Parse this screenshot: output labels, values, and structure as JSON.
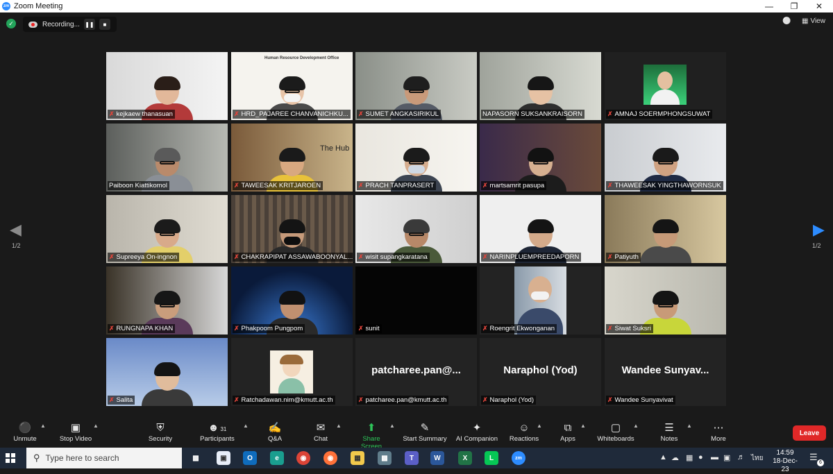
{
  "window": {
    "title": "Zoom Meeting",
    "app_icon_text": "zm",
    "controls": [
      "minimize-icon",
      "maximize-icon",
      "close-icon"
    ]
  },
  "recording": {
    "label": "Recording...",
    "pause_icon": "pause-icon",
    "stop_icon": "stop-icon"
  },
  "view_label": "View",
  "page_indicator": {
    "left": "1/2",
    "right": "1/2"
  },
  "participants": [
    {
      "name": "kejkaew thanasuan",
      "muted": true
    },
    {
      "name": "HRD_PAJAREE CHANVANICHKU...",
      "muted": true,
      "banner": "Human Resource Development Office"
    },
    {
      "name": "SUMET ANGKASIRIKUL",
      "muted": true
    },
    {
      "name": "NAPASORN SUKSANKRAISORN",
      "muted": false,
      "active": true
    },
    {
      "name": "AMNAJ SOERMPHONGSUWAT",
      "muted": true
    },
    {
      "name": "Paiboon Kiattikomol",
      "muted": false
    },
    {
      "name": "TAWEESAK KRITJAROEN",
      "muted": true,
      "banner": "The Hub"
    },
    {
      "name": "PRACH TANPRASERT",
      "muted": true
    },
    {
      "name": "martsamrit pasupa",
      "muted": true
    },
    {
      "name": "THAWEESAK YINGTHAWORNSUK",
      "muted": true
    },
    {
      "name": "Supreeya On-ingnon",
      "muted": true
    },
    {
      "name": "CHAKRAPIPAT ASSAWABOONYAL...",
      "muted": true
    },
    {
      "name": "wisit supangkaratana",
      "muted": true
    },
    {
      "name": "NARINPLUEMPREEDAPORN",
      "muted": true
    },
    {
      "name": "Patiyuth",
      "muted": true
    },
    {
      "name": "RUNGNAPA KHAN",
      "muted": true
    },
    {
      "name": "Phakpoom Pungpom",
      "muted": true
    },
    {
      "name": "sunit",
      "muted": true
    },
    {
      "name": "Roengrit Ekwonganan",
      "muted": true
    },
    {
      "name": "Siwat Suksri",
      "muted": true
    },
    {
      "name": "Salita",
      "muted": true
    },
    {
      "name": "Ratchadawan.nim@kmutt.ac.th",
      "muted": true
    },
    {
      "name": "patcharee.pan@kmutt.ac.th",
      "muted": true,
      "display": "patcharee.pan@..."
    },
    {
      "name": "Naraphol (Yod)",
      "muted": true,
      "display": "Naraphol (Yod)"
    },
    {
      "name": "Wandee Sunyavivat",
      "muted": true,
      "display": "Wandee Sunyav..."
    }
  ],
  "toolbar": {
    "unmute": "Unmute",
    "stop_video": "Stop Video",
    "security": "Security",
    "participants": "Participants",
    "participants_count": "31",
    "qa": "Q&A",
    "chat": "Chat",
    "share_screen": "Share Screen",
    "start_summary": "Start Summary",
    "ai_companion": "AI Companion",
    "reactions": "Reactions",
    "apps": "Apps",
    "whiteboards": "Whiteboards",
    "notes": "Notes",
    "more": "More",
    "leave": "Leave"
  },
  "taskbar": {
    "search_placeholder": "Type here to search",
    "language": "ไทย",
    "time": "14:59",
    "date": "18-Dec-23",
    "notification_count": "6"
  },
  "colors": {
    "accent": "#2d8cff",
    "active_speaker": "#d7e36e",
    "leave": "#e02828",
    "share_green": "#2ec55a"
  }
}
